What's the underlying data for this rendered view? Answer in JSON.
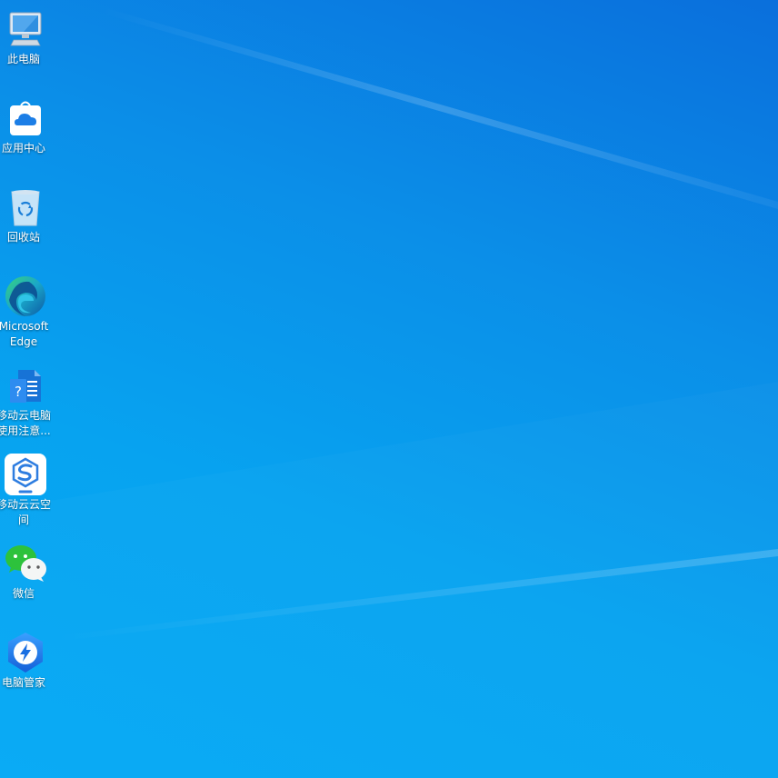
{
  "desktop": {
    "icons": [
      {
        "label": "此电脑",
        "icon": "computer-icon"
      },
      {
        "label": "应用中心",
        "icon": "app-center-icon"
      },
      {
        "label": "回收站",
        "icon": "recycle-bin-icon"
      },
      {
        "label": "Microsoft\nEdge",
        "icon": "edge-browser-icon"
      },
      {
        "label": "移动云电脑\n使用注意...",
        "icon": "document-help-icon"
      },
      {
        "label": "移动云云空\n间",
        "icon": "cloud-space-icon"
      },
      {
        "label": "微信",
        "icon": "wechat-icon"
      },
      {
        "label": "电脑管家",
        "icon": "pc-manager-icon"
      }
    ]
  },
  "colors": {
    "wallpaper_top": "#0a6fdc",
    "wallpaper_bottom": "#05a9f5"
  }
}
